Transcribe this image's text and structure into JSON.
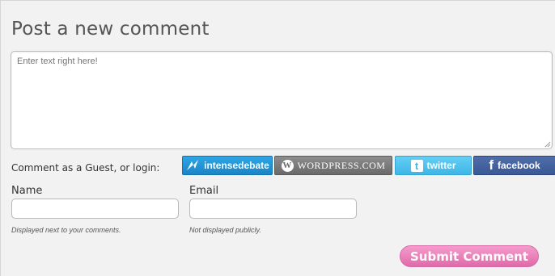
{
  "comment_form": {
    "title": "Post a new comment",
    "textarea_placeholder": "Enter text right here!",
    "login_prompt": "Comment as a Guest, or login:",
    "services": [
      {
        "name": "intensedebate",
        "icon": "intensedebate-icon"
      },
      {
        "name": "WORDPRESS.COM",
        "icon": "wordpress-icon"
      },
      {
        "name": "twitter",
        "icon": "twitter-icon"
      },
      {
        "name": "facebook",
        "icon": "facebook-icon"
      }
    ],
    "name_label": "Name",
    "name_hint": "Displayed next to your comments.",
    "email_label": "Email",
    "email_hint": "Not displayed publicly.",
    "submit_label": "Submit Comment"
  },
  "colors": {
    "background": "#f2f2f2",
    "intensedebate": "#1a84c6",
    "wordpress": "#6a6a6a",
    "twitter": "#3fb6e6",
    "facebook": "#3b5897",
    "submit": "#e06aa8"
  }
}
